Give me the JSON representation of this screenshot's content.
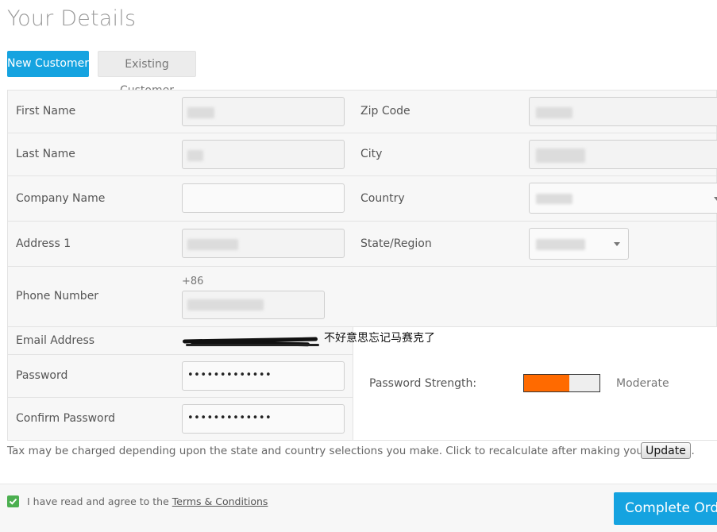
{
  "title": "Your Details",
  "tabs": {
    "new_customer": "New Customer",
    "existing_customer": "Existing Customer"
  },
  "labels": {
    "first_name": "First Name",
    "last_name": "Last Name",
    "company_name": "Company Name",
    "address_1": "Address 1",
    "phone_number": "Phone Number",
    "email_address": "Email Address",
    "password": "Password",
    "confirm_password": "Confirm Password",
    "zip_code": "Zip Code",
    "city": "City",
    "country": "Country",
    "state_region": "State/Region"
  },
  "phone_prefix": "+86",
  "password_value": "•••••••••••••",
  "confirm_password_value": "•••••••••••••",
  "annotation": "不好意思忘记马赛克了",
  "password_strength": {
    "label": "Password Strength:",
    "value": "Moderate",
    "level": 0.6,
    "color": "#ff6a00"
  },
  "tax_note": "Tax may be charged depending upon the state and country selections you make. Click to recalculate after making your choices.",
  "update_button": "Update",
  "terms": {
    "prefix": "I have read and agree to the ",
    "link": "Terms & Conditions"
  },
  "complete_order": "Complete Order"
}
